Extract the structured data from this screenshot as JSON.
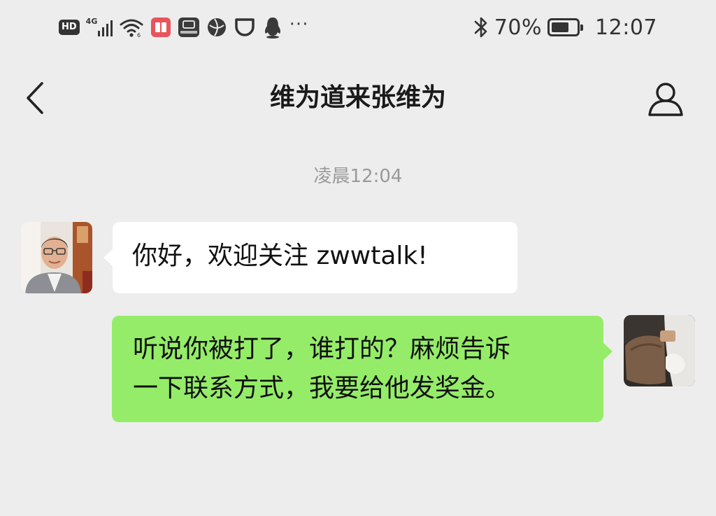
{
  "status_bar": {
    "hd_label": "HD",
    "network_label": "4G",
    "more_icon": "···",
    "battery_percent": "70%",
    "battery_level": 0.7,
    "time": "12:07",
    "icons": [
      "hd-icon",
      "signal-4g-icon",
      "wifi-icon",
      "red-app-icon",
      "huawei-icon",
      "globe-icon",
      "cup-icon",
      "penguin-icon",
      "more-icon",
      "bluetooth-icon",
      "battery-icon"
    ]
  },
  "header": {
    "back_icon": "chevron-left-icon",
    "title": "维为道来张维为",
    "profile_icon": "person-icon"
  },
  "chat": {
    "timestamp": "凌晨12:04",
    "messages": [
      {
        "side": "incoming",
        "text": "你好，欢迎关注 zwwtalk!",
        "bubble_color": "#ffffff"
      },
      {
        "side": "outgoing",
        "lines": [
          "听说你被打了，谁打的？麻烦告诉",
          "一下联系方式，我要给他发奖金。"
        ],
        "bubble_color": "#95ec69"
      }
    ]
  },
  "colors": {
    "background": "#ededed",
    "outgoing_bubble": "#95ec69",
    "incoming_bubble": "#ffffff",
    "timestamp_text": "#9a9a9a"
  }
}
